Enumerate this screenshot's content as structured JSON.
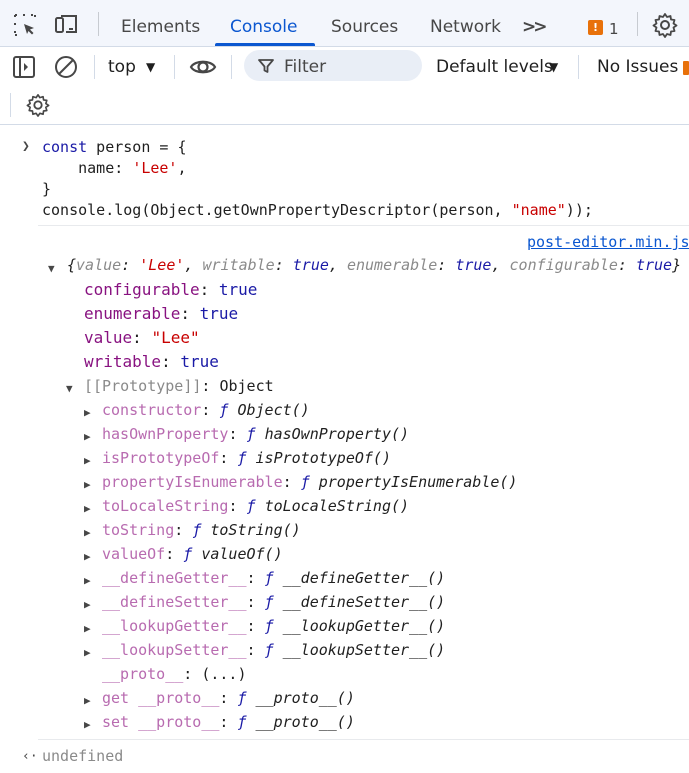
{
  "tabs": {
    "items": [
      "Elements",
      "Console",
      "Sources",
      "Network"
    ],
    "more": ">>",
    "issues_count": "1",
    "issues_icon": "!"
  },
  "toolbar": {
    "context": "top",
    "filter_placeholder": "Filter",
    "levels": "Default levels",
    "no_issues": "No Issues"
  },
  "console": {
    "input_lines": [
      {
        "kw": "const",
        "rest": " person = {"
      },
      {
        "indent": "    ",
        "key": "name",
        "colon": ": ",
        "str": "'Lee'",
        "tail": ","
      },
      {
        "plain": "}"
      },
      {
        "plain": "console.log(Object.getOwnPropertyDescriptor(person, ",
        "str": "\"name\"",
        "tail": "));"
      }
    ],
    "source_link": "post-editor.min.js",
    "summary": {
      "open": "{",
      "k1": "value",
      "v1": "'Lee'",
      "k2": "writable",
      "v2": "true",
      "k3": "enumerable",
      "v3": "true",
      "k4": "configurable",
      "v4": "true",
      "close": "}"
    },
    "props": [
      {
        "key": "configurable",
        "value": "true",
        "type": "bool"
      },
      {
        "key": "enumerable",
        "value": "true",
        "type": "bool"
      },
      {
        "key": "value",
        "value": "\"Lee\"",
        "type": "str"
      },
      {
        "key": "writable",
        "value": "true",
        "type": "bool"
      }
    ],
    "prototype": {
      "key": "[[Prototype]]",
      "value": "Object"
    },
    "proto_members": [
      {
        "key": "constructor",
        "f": "ƒ",
        "fn": "Object()"
      },
      {
        "key": "hasOwnProperty",
        "f": "ƒ",
        "fn": "hasOwnProperty()"
      },
      {
        "key": "isPrototypeOf",
        "f": "ƒ",
        "fn": "isPrototypeOf()"
      },
      {
        "key": "propertyIsEnumerable",
        "f": "ƒ",
        "fn": "propertyIsEnumerable()"
      },
      {
        "key": "toLocaleString",
        "f": "ƒ",
        "fn": "toLocaleString()"
      },
      {
        "key": "toString",
        "f": "ƒ",
        "fn": "toString()"
      },
      {
        "key": "valueOf",
        "f": "ƒ",
        "fn": "valueOf()"
      },
      {
        "key": "__defineGetter__",
        "f": "ƒ",
        "fn": "__defineGetter__()"
      },
      {
        "key": "__defineSetter__",
        "f": "ƒ",
        "fn": "__defineSetter__()"
      },
      {
        "key": "__lookupGetter__",
        "f": "ƒ",
        "fn": "__lookupGetter__()"
      },
      {
        "key": "__lookupSetter__",
        "f": "ƒ",
        "fn": "__lookupSetter__()"
      }
    ],
    "proto_accessor": {
      "key": "__proto__",
      "value": "(...)"
    },
    "proto_get": {
      "key": "get __proto__",
      "f": "ƒ",
      "fn": "__proto__()"
    },
    "proto_set": {
      "key": "set __proto__",
      "f": "ƒ",
      "fn": "__proto__()"
    },
    "result": "undefined"
  }
}
